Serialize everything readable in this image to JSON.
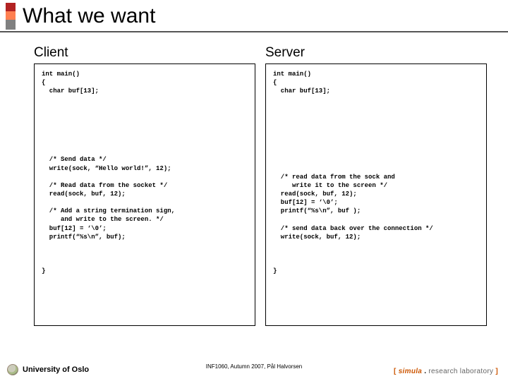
{
  "title": "What we want",
  "columns": {
    "left": {
      "heading": "Client",
      "code": "int main()\n{\n  char buf[13];\n\n\n\n\n\n\n\n  /* Send data */\n  write(sock, “Hello world!”, 12);\n\n  /* Read data from the socket */\n  read(sock, buf, 12);\n\n  /* Add a string termination sign,\n     and write to the screen. */\n  buf[12] = ‘\\0’;\n  printf(“%s\\n”, buf);\n\n\n\n}"
    },
    "right": {
      "heading": "Server",
      "code": "int main()\n{\n  char buf[13];\n\n\n\n\n\n\n\n\n\n  /* read data from the sock and\n     write it to the screen */\n  read(sock, buf, 12);\n  buf[12] = ‘\\0’;\n  printf(“%s\\n”, buf );\n\n  /* send data back over the connection */\n  write(sock, buf, 12);\n\n\n\n}"
    }
  },
  "footer": {
    "left": "University of Oslo",
    "mid": "INF1060, Autumn 2007, Pål Halvorsen",
    "right": {
      "lbracket": "[",
      "simula": " simula ",
      "dot": ".",
      "rest": " research laboratory ",
      "rbracket": "]"
    }
  }
}
